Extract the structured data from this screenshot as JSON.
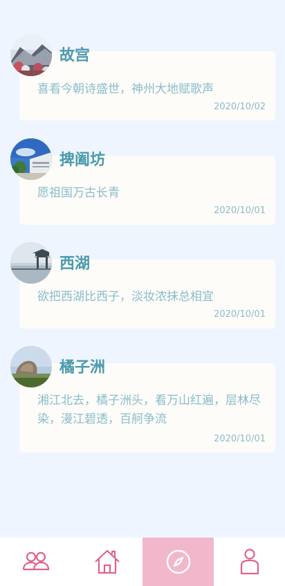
{
  "posts": [
    {
      "title": "故宫",
      "body": "喜看今朝诗盛世，神州大地赋歌声",
      "date": "2020/10/02",
      "avatar_icon": "forbidden-city-photo"
    },
    {
      "title": "捭阖坊",
      "body": "愿祖国万古长青",
      "date": "2020/10/01",
      "avatar_icon": "archway-photo"
    },
    {
      "title": "西湖",
      "body": "欲把西湖比西子，淡妆浓抹总相宜",
      "date": "2020/10/01",
      "avatar_icon": "west-lake-pavilion-photo"
    },
    {
      "title": "橘子洲",
      "body": "湘江北去，橘子洲头，看万山红遍，层林尽染，漫江碧透，百舸争流",
      "date": "2020/10/01",
      "avatar_icon": "orange-isle-statue-photo"
    }
  ],
  "tabbar": {
    "tabs": [
      {
        "icon": "people-icon",
        "active": false
      },
      {
        "icon": "home-icon",
        "active": false
      },
      {
        "icon": "compass-icon",
        "active": true
      },
      {
        "icon": "user-icon",
        "active": false
      }
    ]
  },
  "colors": {
    "background": "#eef5ff",
    "card": "#fdfcf8",
    "title": "#4a9aae",
    "text": "#89bccb",
    "accent": "#e0608f",
    "active_tab": "#f1b8cc"
  }
}
